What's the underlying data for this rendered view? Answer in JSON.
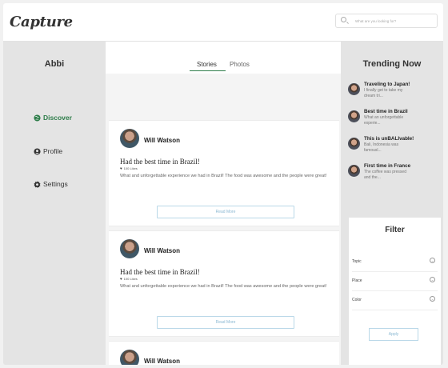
{
  "app": {
    "logo": "Capture"
  },
  "search": {
    "placeholder": "What are you looking for?"
  },
  "sidebar": {
    "user_name": "Abbi",
    "items": [
      {
        "label": "Discover",
        "icon": "globe-icon",
        "active": true
      },
      {
        "label": "Profile",
        "icon": "user-icon",
        "active": false
      },
      {
        "label": "Settings",
        "icon": "gear-icon",
        "active": false
      }
    ]
  },
  "feed": {
    "tabs": [
      {
        "label": "Stories",
        "active": true
      },
      {
        "label": "Photos",
        "active": false
      }
    ],
    "posts": [
      {
        "author": "Will Watson",
        "title": "Had the best time in Brazil!",
        "likes": "100 Likes",
        "body": "What and unforgettable experience we had in Brazil! The food was awesome and the people were great!",
        "button": "Read More"
      },
      {
        "author": "Will Watson",
        "title": "Had the best time in Brazil!",
        "likes": "100 Likes",
        "body": "What and unforgettable experience we had in Brazil! The food was awesome and the people were great!",
        "button": "Read More"
      },
      {
        "author": "Will Watson"
      }
    ]
  },
  "trending": {
    "title": "Trending Now",
    "items": [
      {
        "title": "Traveling to Japan!",
        "snippet": "I finally get to take my dream tri..."
      },
      {
        "title": "Best time in Brazil",
        "snippet": "What an unforgettable experie..."
      },
      {
        "title": "This is unBALIvable!",
        "snippet": "Bali, Indonesia was famousl..."
      },
      {
        "title": "First time in France",
        "snippet": "The coffee was pressed and the..."
      }
    ]
  },
  "filter": {
    "title": "Filter",
    "rows": [
      {
        "label": "Topic"
      },
      {
        "label": "Place"
      },
      {
        "label": "Color"
      }
    ],
    "apply_label": "Apply"
  },
  "colors": {
    "accent": "#2e7d4a",
    "button_border": "#b9d8e8",
    "button_text": "#8ab8d2"
  }
}
